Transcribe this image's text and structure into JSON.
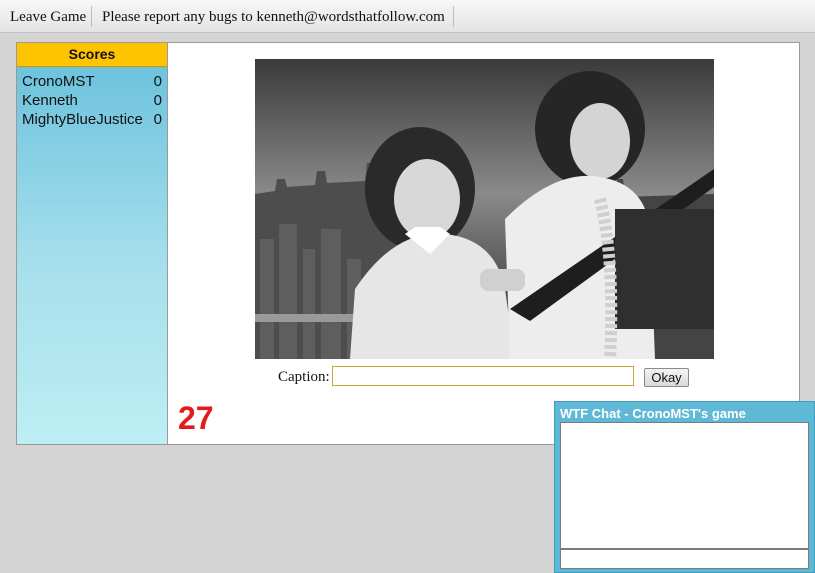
{
  "menubar": {
    "leave_label": "Leave Game",
    "bug_notice": "Please report any bugs to kenneth@wordsthatfollow.com"
  },
  "scores": {
    "title": "Scores",
    "players": [
      {
        "name": "CronoMST",
        "score": "0"
      },
      {
        "name": "Kenneth",
        "score": "0"
      },
      {
        "name": "MightyBlueJustice",
        "score": "0"
      }
    ]
  },
  "game": {
    "caption_label": "Caption:",
    "caption_value": "",
    "okay_label": "Okay",
    "timer": "27"
  },
  "chat": {
    "title": "WTF Chat - CronoMST's game",
    "input_value": ""
  },
  "colors": {
    "scores_header": "#ffc400",
    "timer": "#e21c1c",
    "chat_accent": "#5fb9d6"
  }
}
